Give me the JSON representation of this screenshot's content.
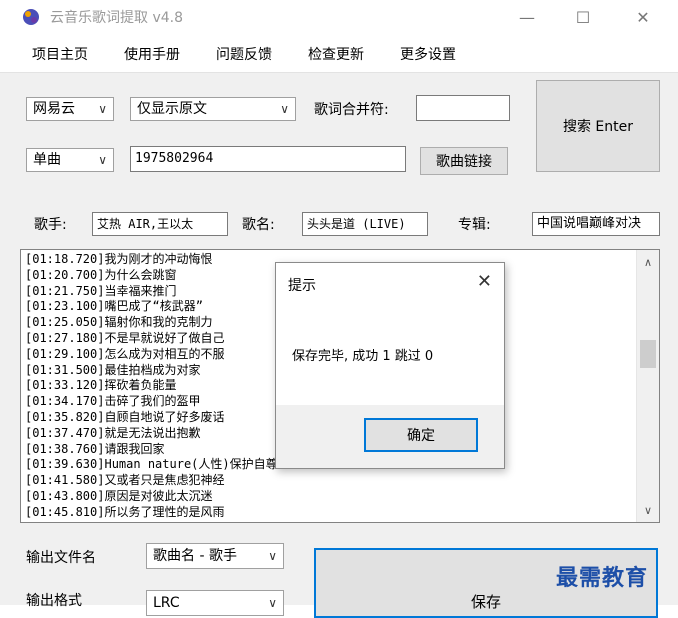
{
  "window": {
    "title": "云音乐歌词提取 v4.8",
    "controls": {
      "minimize": "—",
      "maximize": "☐",
      "close": "✕"
    }
  },
  "menu": [
    "项目主页",
    "使用手册",
    "问题反馈",
    "检查更新",
    "更多设置"
  ],
  "search": {
    "source_select": "网易云",
    "display_select": "仅显示原文",
    "merge_label": "歌词合并符:",
    "merge_value": "",
    "type_select": "单曲",
    "id_value": "1975802964",
    "link_button": "歌曲链接",
    "search_button": "搜索 Enter"
  },
  "info": {
    "singer_label": "歌手:",
    "singer_value": "艾热 AIR,王以太",
    "song_label": "歌名:",
    "song_value": "头头是道 (LIVE)",
    "album_label": "专辑:",
    "album_value": "中国说唱巅峰对决"
  },
  "lyrics": [
    "[01:18.720]我为刚才的冲动悔恨",
    "[01:20.700]为什么会跳窗",
    "[01:21.750]当幸福来推门",
    "[01:23.100]嘴巴成了“核武器”",
    "[01:25.050]辐射你和我的克制力",
    "[01:27.180]不是早就说好了做自己",
    "[01:29.100]怎么成为对相互的不服",
    "[01:31.500]最佳拍档成为对家",
    "[01:33.120]挥砍着负能量",
    "[01:34.170]击碎了我们的盔甲",
    "[01:35.820]自顾自地说了好多废话",
    "[01:37.470]就是无法说出抱歉",
    "[01:38.760]请跟我回家",
    "[01:39.630]Human nature(人性)保护自尊心",
    "[01:41.580]又或者只是焦虑犯神经",
    "[01:43.800]原因是对彼此太沉迷",
    "[01:45.810]所以务了理性的是风雨"
  ],
  "dialog": {
    "title": "提示",
    "close": "✕",
    "message": "保存完毕, 成功 1 跳过 0",
    "ok_button": "确定"
  },
  "output": {
    "filename_label": "输出文件名",
    "filename_select": "歌曲名 - 歌手",
    "format_label": "输出格式",
    "format_select": "LRC",
    "save_button": "保存"
  },
  "watermark": "最需教育"
}
